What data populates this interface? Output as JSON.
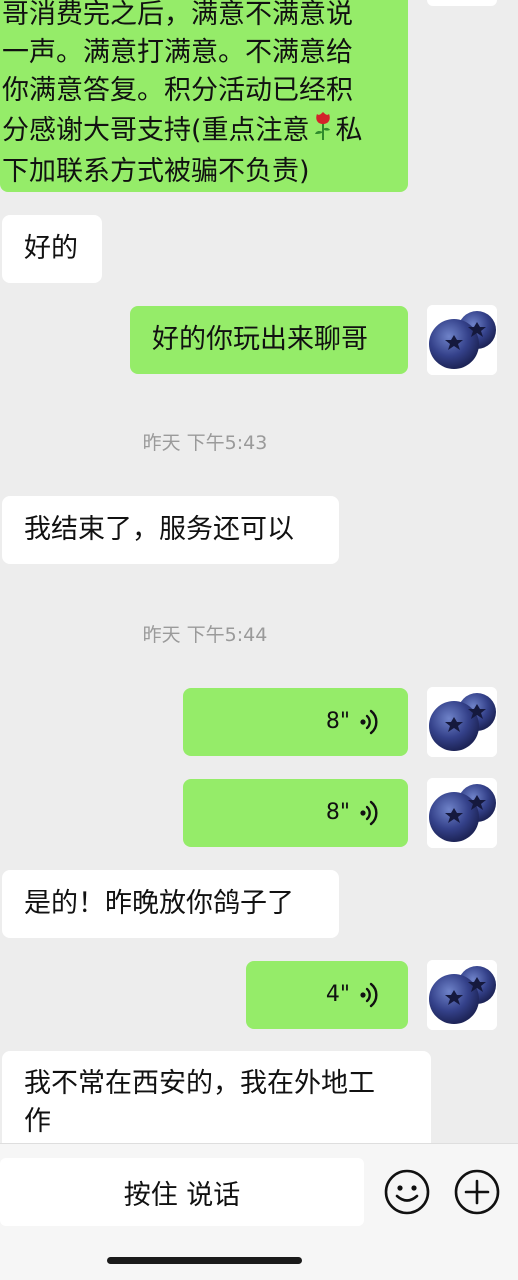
{
  "messages": {
    "m1_lines": [
      "哥消费完之后，满意不满意说",
      "一声。满意打满意。不满意给",
      "你满意答复。积分活动已经积",
      "分感谢大哥支持(重点注意",
      "私",
      "下加联系方式被骗不负责)"
    ],
    "m2": "好的",
    "m3": "好的你玩出来聊哥",
    "ts1": "昨天 下午5:43",
    "m4": "我结束了，服务还可以",
    "ts2": "昨天 下午5:44",
    "v1": "8\"",
    "v2": "8\"",
    "m5": "是的！昨晚放你鸽子了",
    "v3": "4\"",
    "m6_lines": [
      "我不常在西安的，我在外地工",
      "作"
    ]
  },
  "input": {
    "hold_to_talk": "按住 说话"
  },
  "icons": {
    "emoji": "smiley-icon",
    "more": "plus-circle-icon",
    "voice": "voice-wave-icon",
    "avatar": "blueberry-avatar",
    "rose": "rose-emoji"
  },
  "colors": {
    "background": "#ededed",
    "outgoing_bubble": "#95ec69",
    "incoming_bubble": "#ffffff",
    "timestamp": "#9a9a9a"
  }
}
